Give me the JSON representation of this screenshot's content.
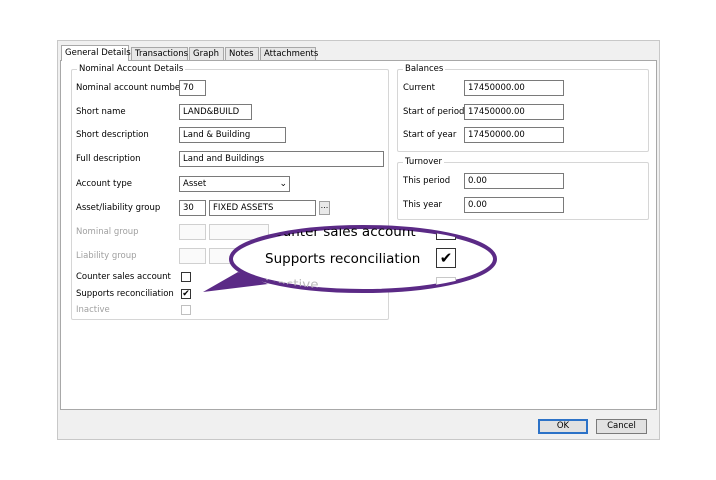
{
  "tabs": [
    {
      "label": "General Details",
      "active": true
    },
    {
      "label": "Transactions",
      "active": false
    },
    {
      "label": "Graph",
      "active": false
    },
    {
      "label": "Notes",
      "active": false
    },
    {
      "label": "Attachments",
      "active": false
    }
  ],
  "nominal_details": {
    "legend": "Nominal Account Details",
    "account_number": {
      "label": "Nominal account number",
      "value": "70"
    },
    "short_name": {
      "label": "Short name",
      "value": "LAND&BUILD"
    },
    "short_description": {
      "label": "Short description",
      "value": "Land & Building"
    },
    "full_description": {
      "label": "Full description",
      "value": "Land and Buildings"
    },
    "account_type": {
      "label": "Account type",
      "value": "Asset"
    },
    "asset_liability_group": {
      "label": "Asset/liability group",
      "code": "30",
      "name": "FIXED ASSETS",
      "ellipsis": "..."
    },
    "nominal_group": {
      "label": "Nominal group"
    },
    "liability_group": {
      "label": "Liability group"
    },
    "counter_sales": {
      "label": "Counter sales account",
      "checked": false
    },
    "supports_reconciliation": {
      "label": "Supports reconciliation",
      "checked": true
    },
    "inactive": {
      "label": "Inactive",
      "checked": false
    }
  },
  "balances": {
    "legend": "Balances",
    "current": {
      "label": "Current",
      "value": "17450000.00"
    },
    "start_of_period": {
      "label": "Start of period",
      "value": "17450000.00"
    },
    "start_of_year": {
      "label": "Start of year",
      "value": "17450000.00"
    }
  },
  "turnover": {
    "legend": "Turnover",
    "this_period": {
      "label": "This period",
      "value": "0.00"
    },
    "this_year": {
      "label": "This year",
      "value": "0.00"
    }
  },
  "buttons": {
    "ok": "OK",
    "cancel": "Cancel"
  },
  "callout": {
    "counter_sales_label": "Counter sales account",
    "supports_reconciliation_label": "Supports reconciliation",
    "inactive_partial": "Inactive",
    "checkmark": "✔",
    "border_color": "#5b2a86"
  }
}
